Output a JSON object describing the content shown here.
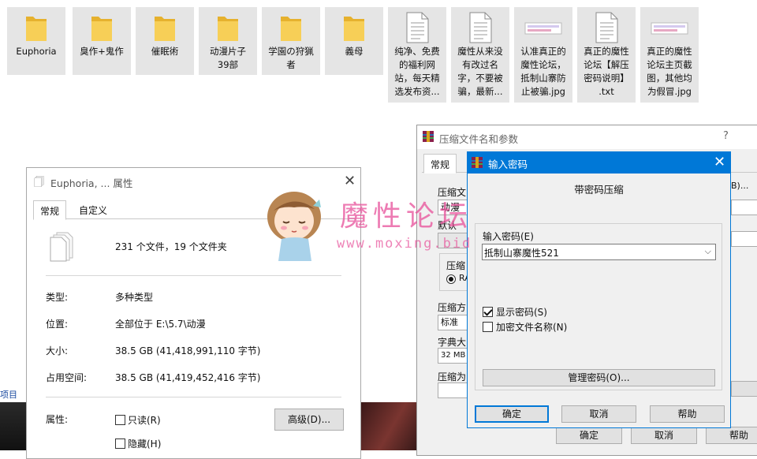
{
  "files": [
    {
      "name": "Euphoria",
      "type": "folder"
    },
    {
      "name": "臭作+鬼作",
      "type": "folder"
    },
    {
      "name": "催眠術",
      "type": "folder"
    },
    {
      "name": "动漫片子\n39部",
      "type": "folder"
    },
    {
      "name": "学園の狩猟\n者",
      "type": "folder"
    },
    {
      "name": "義母",
      "type": "folder"
    },
    {
      "name": "纯净、免费\n的福利网\n站，每天精\n选发布资...",
      "type": "document"
    },
    {
      "name": "魔性从来没\n有改过名\n字，不要被\n骗，最新...",
      "type": "document"
    },
    {
      "name": "认准真正的\n魔性论坛，\n抵制山寨防\n止被骗.jpg",
      "type": "image"
    },
    {
      "name": "真正的魔性\n论坛【解压\n密码说明】\n.txt",
      "type": "document"
    },
    {
      "name": "真正的魔性\n论坛主页截\n图，其他均\n为假冒.jpg",
      "type": "image"
    }
  ],
  "left_edge_text": "项目",
  "watermark": {
    "name": "魔性论坛",
    "url": "www.moxing.bid"
  },
  "properties": {
    "title": "Euphoria, ... 属性",
    "tabs": [
      "常规",
      "自定义"
    ],
    "summary": "231 个文件，19 个文件夹",
    "rows": [
      {
        "label": "类型:",
        "value": "多种类型"
      },
      {
        "label": "位置:",
        "value": "全部位于 E:\\5.7\\动漫"
      },
      {
        "label": "大小:",
        "value": "38.5 GB (41,418,991,110 字节)"
      },
      {
        "label": "占用空间:",
        "value": "38.5 GB (41,419,452,416 字节)"
      }
    ],
    "attr_label": "属性:",
    "readonly_label": "只读(R)",
    "hidden_label": "隐藏(H)",
    "advanced_button": "高级(D)..."
  },
  "archive": {
    "title": "压缩文件名和参数",
    "help_mark": "?",
    "tab_general": "常规",
    "partial_labels": [
      "压缩文",
      "动漫",
      "默认",
      "压缩",
      "RA",
      "压缩方",
      "标准",
      "字典大",
      "32 MB",
      "压缩为"
    ],
    "right_partial": "B)...",
    "ok": "确定",
    "cancel": "取消",
    "help": "帮助"
  },
  "password": {
    "title": "输入密码",
    "heading": "带密码压缩",
    "field_label": "输入密码(E)",
    "field_value": "抵制山寨魔性521",
    "show_password": "显示密码(S)",
    "show_password_checked": true,
    "encrypt_names": "加密文件名称(N)",
    "encrypt_names_checked": false,
    "manage_button": "管理密码(O)...",
    "ok": "确定",
    "cancel": "取消",
    "help": "帮助"
  },
  "colors": {
    "accent": "#0078d7",
    "folder": "#f5c842",
    "watermark": "#e8509a"
  }
}
